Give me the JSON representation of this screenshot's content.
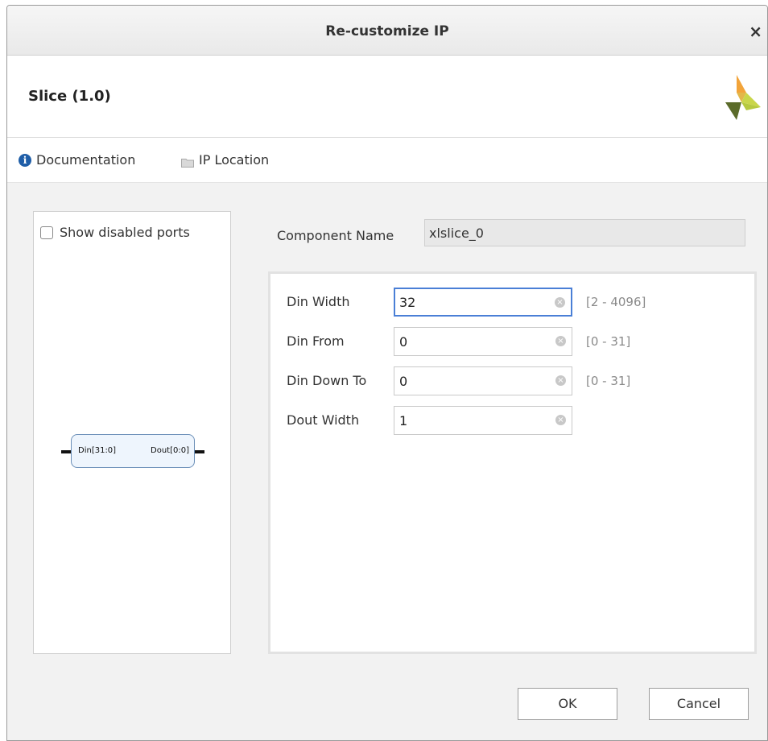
{
  "window": {
    "title": "Re-customize IP",
    "close_glyph": "×"
  },
  "header": {
    "ip_title": "Slice (1.0)",
    "logo_icon": "xilinx-logo-icon"
  },
  "links": [
    {
      "label": "Documentation",
      "icon": "info-icon"
    },
    {
      "label": "IP Location",
      "icon": "folder-icon"
    }
  ],
  "symbol_panel": {
    "show_disabled_ports_label": "Show disabled ports",
    "show_disabled_ports_checked": false,
    "block": {
      "input_port": "Din[31:0]",
      "output_port": "Dout[0:0]"
    }
  },
  "component": {
    "label": "Component Name",
    "value": "xlslice_0"
  },
  "parameters": [
    {
      "label": "Din Width",
      "value": "32",
      "range": "[2 - 4096]",
      "focused": true
    },
    {
      "label": "Din From",
      "value": "0",
      "range": "[0 - 31]"
    },
    {
      "label": "Din Down To",
      "value": "0",
      "range": "[0 - 31]"
    },
    {
      "label": "Dout Width",
      "value": "1",
      "range": ""
    }
  ],
  "buttons": {
    "ok": "OK",
    "cancel": "Cancel"
  }
}
